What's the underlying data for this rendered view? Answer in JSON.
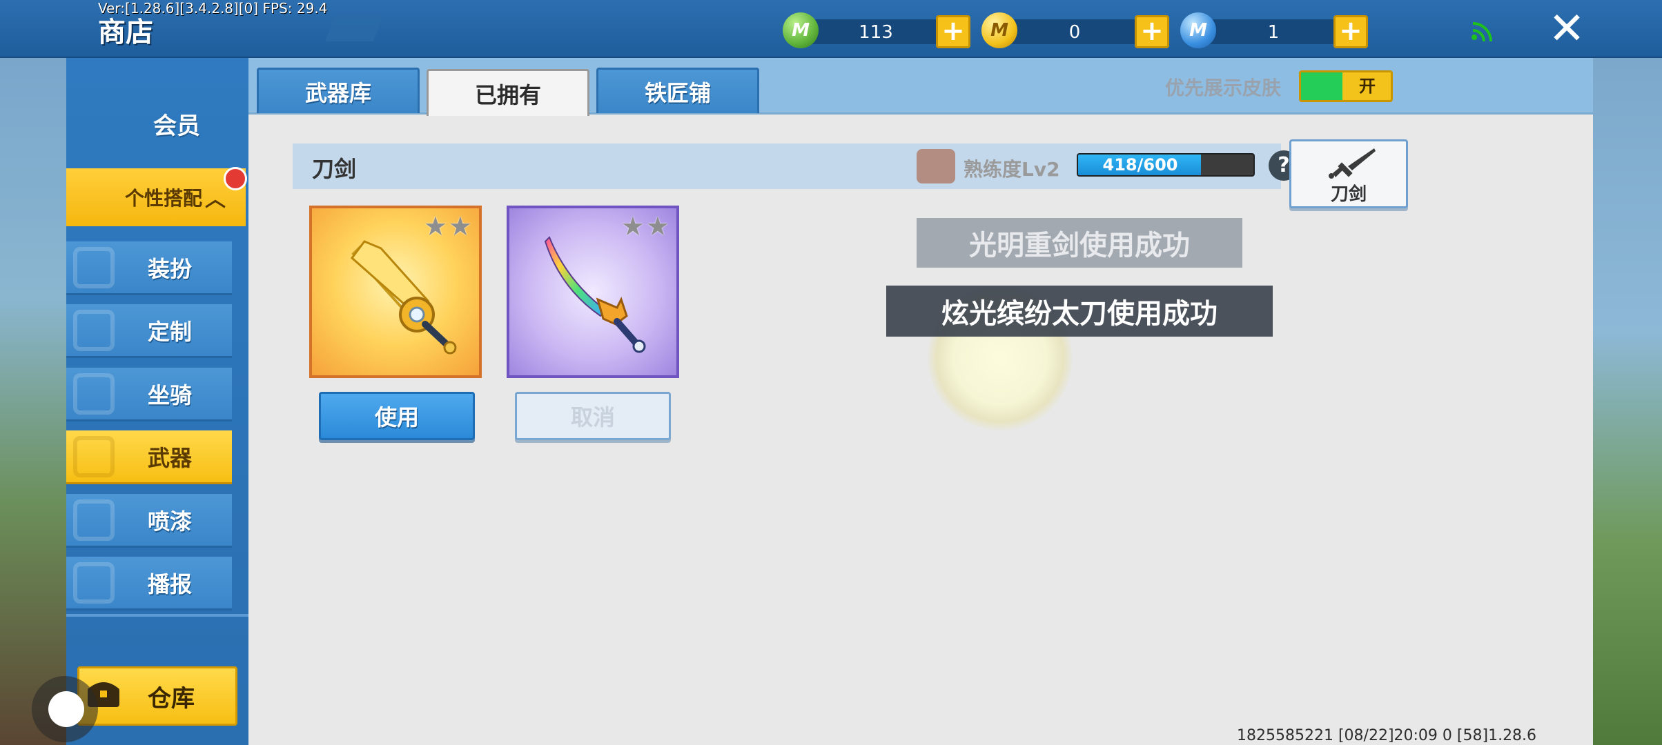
{
  "header": {
    "version": "Ver:[1.28.6][3.4.2.8][0] FPS: 29.4",
    "title": "商店",
    "currencies": [
      {
        "icon": "green-gem-icon",
        "value": "113",
        "color": "#5fb33a"
      },
      {
        "icon": "gold-coin-icon",
        "value": "0",
        "color": "#f2c11b"
      },
      {
        "icon": "blue-coin-icon",
        "value": "1",
        "color": "#3a8fe0"
      }
    ],
    "plus_symbol": "+",
    "close_symbol": "✕",
    "wifi_icon": "wifi-signal-icon"
  },
  "sidebar": {
    "member": "会员",
    "group": "个性搭配",
    "group_arrow": "︿",
    "items": [
      {
        "label": "装扮"
      },
      {
        "label": "定制"
      },
      {
        "label": "坐骑"
      },
      {
        "label": "武器"
      },
      {
        "label": "喷漆"
      },
      {
        "label": "播报"
      }
    ],
    "warehouse": "仓库"
  },
  "tabs": [
    {
      "label": "武器库"
    },
    {
      "label": "已拥有"
    },
    {
      "label": "铁匠铺"
    }
  ],
  "preference": {
    "label": "优先展示皮肤",
    "toggle_label": "开",
    "toggle_on": true
  },
  "category": {
    "name": "刀剑",
    "proficiency_label": "熟练度Lv2",
    "progress_text": "418/600",
    "progress": 0.7,
    "help": "?",
    "button_label": "刀剑"
  },
  "items": [
    {
      "stars": "★★",
      "button": "使用",
      "rarity_color": "#f5a23a"
    },
    {
      "stars": "★★",
      "button": "取消",
      "rarity_color": "#9f86e0"
    }
  ],
  "toasts": [
    "光明重剑使用成功",
    "炫光缤纷太刀使用成功"
  ],
  "footer": "1825585221   [08/22]20:09 0 [58]1.28.6"
}
